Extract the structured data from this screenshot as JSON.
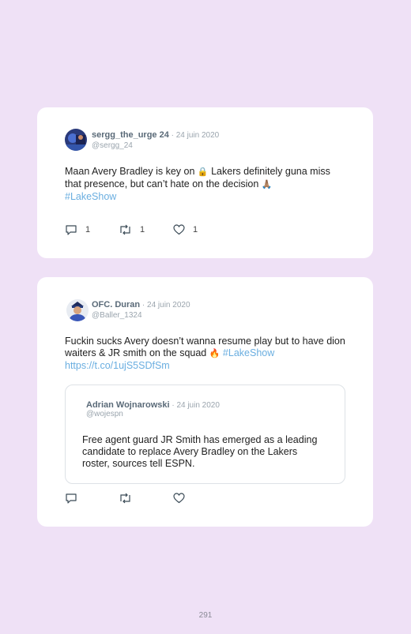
{
  "tweets": [
    {
      "display_name": "sergg_the_urge 24",
      "date": "24 juin 2020",
      "handle": "@sergg_24",
      "text_before": "Maan Avery Bradley is key on ",
      "emoji1": "🔒",
      "text_mid": " Lakers definitely guna miss that presence, but can’t hate on the decision ",
      "emoji2": "🙏🏽",
      "hashtag": "#LakeShow",
      "replies": "1",
      "retweets": "1",
      "likes": "1"
    },
    {
      "display_name": "OFC. Duran",
      "date": "24 juin 2020",
      "handle": "@Baller_1324",
      "text_before": "Fuckin sucks Avery doesn’t wanna resume play but to have dion waiters & JR smith on the squad ",
      "emoji1": "🔥",
      "hashtag": "#LakeShow",
      "link": "https://t.co/1ujS5SDfSm",
      "quoted": {
        "display_name": "Adrian Wojnarowski",
        "date": "24 juin 2020",
        "handle": "@wojespn",
        "text": "Free agent guard JR Smith has emerged as a leading candidate to replace Avery Bradley on the Lakers roster, sources tell ESPN."
      }
    }
  ],
  "page_number": "291",
  "icons": {
    "reply": "reply-icon",
    "retweet": "retweet-icon",
    "like": "heart-icon"
  }
}
